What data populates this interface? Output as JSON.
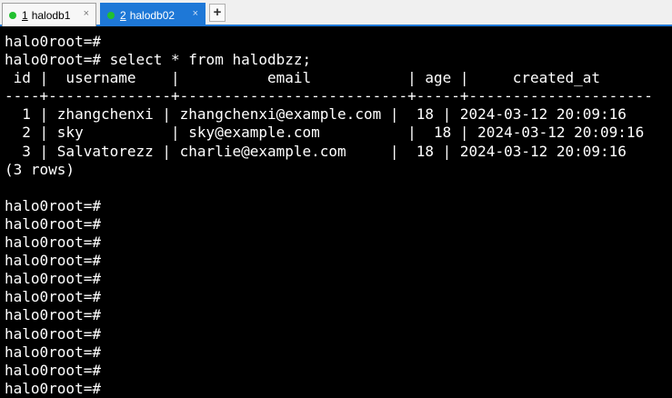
{
  "tabs": [
    {
      "number": "1",
      "title": "halodb1",
      "close": "×",
      "status_color": "#22c030",
      "active": false
    },
    {
      "number": "2",
      "title": "halodb02",
      "close": "×",
      "status_color": "#22c030",
      "active": true
    }
  ],
  "new_tab_label": "+",
  "terminal_lines": [
    "halo0root=#",
    "halo0root=# select * from halodbzz;",
    " id |  username    |          email           | age |     created_at",
    "----+--------------+--------------------------+-----+---------------------",
    "  1 | zhangchenxi | zhangchenxi@example.com |  18 | 2024-03-12 20:09:16",
    "  2 | sky          | sky@example.com          |  18 | 2024-03-12 20:09:16",
    "  3 | Salvatorezz | charlie@example.com     |  18 | 2024-03-12 20:09:16",
    "(3 rows)",
    "",
    "halo0root=#",
    "halo0root=#",
    "halo0root=#",
    "halo0root=#",
    "halo0root=#",
    "halo0root=#",
    "halo0root=#",
    "halo0root=#",
    "halo0root=#",
    "halo0root=#",
    "halo0root=#"
  ],
  "colors": {
    "active_tab": "#1e78d7",
    "terminal_bg": "#000000",
    "terminal_fg": "#ffffff",
    "status_dot": "#22c030"
  }
}
